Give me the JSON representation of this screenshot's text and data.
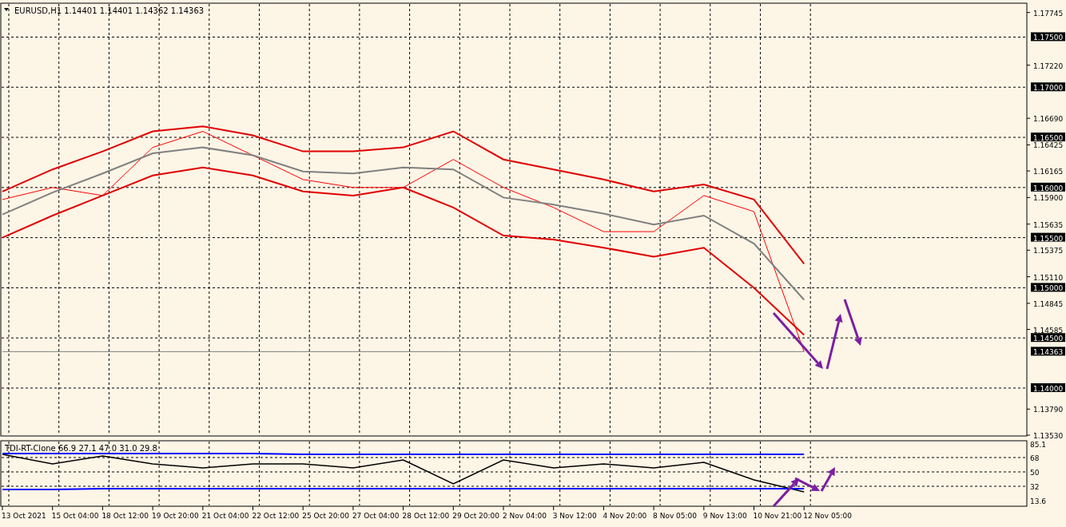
{
  "main": {
    "header": "EURUSD,H1  1.14401 1.14401 1.14362 1.14363",
    "chart_data": {
      "type": "line",
      "grid": true,
      "series": [
        {
          "color": "#ff0000",
          "values": [
            1.1588,
            1.16,
            1.1592,
            1.164,
            1.1656,
            1.1632,
            1.1608,
            1.16,
            1.16,
            1.1628,
            1.16,
            1.158,
            1.1556,
            1.1556,
            1.1592,
            1.1576,
            1.14363
          ]
        },
        {
          "color": "#e00000",
          "values": [
            1.1596,
            1.1618,
            1.1636,
            1.1656,
            1.1661,
            1.1652,
            1.1636,
            1.1636,
            1.164,
            1.1656,
            1.1628,
            1.1618,
            1.1608,
            1.1596,
            1.1603,
            1.1588,
            1.1524
          ]
        },
        {
          "color": "#808080",
          "values": [
            1.1573,
            1.1595,
            1.1614,
            1.1634,
            1.164,
            1.1632,
            1.1616,
            1.1614,
            1.162,
            1.1618,
            1.159,
            1.1583,
            1.1574,
            1.1563,
            1.1572,
            1.1544,
            1.1488
          ]
        },
        {
          "color": "#e00000",
          "values": [
            1.155,
            1.1572,
            1.1592,
            1.1612,
            1.162,
            1.1612,
            1.1596,
            1.1592,
            1.16,
            1.158,
            1.1552,
            1.1548,
            1.154,
            1.1531,
            1.154,
            1.15,
            1.1453
          ]
        },
        {
          "color": "#808080",
          "values": [
            1.14363,
            1.14363,
            1.14363,
            1.14363,
            1.14363,
            1.14363,
            1.14363,
            1.14363,
            1.14363,
            1.14363,
            1.14363,
            1.14363,
            1.14363,
            1.14363,
            1.14363,
            1.14363,
            1.14363
          ]
        }
      ],
      "ylim": [
        1.1353,
        1.1783
      ],
      "yticks": [
        {
          "value": 1.17745,
          "label": "1.17745"
        },
        {
          "value": 1.175,
          "label": "1.17500"
        },
        {
          "value": 1.1722,
          "label": "1.17220"
        },
        {
          "value": 1.17,
          "label": "1.17000"
        },
        {
          "value": 1.1669,
          "label": "1.16690"
        },
        {
          "value": 1.165,
          "label": "1.16500"
        },
        {
          "value": 1.16425,
          "label": "1.16425"
        },
        {
          "value": 1.16165,
          "label": "1.16165"
        },
        {
          "value": 1.16,
          "label": "1.16000"
        },
        {
          "value": 1.159,
          "label": "1.15900"
        },
        {
          "value": 1.15635,
          "label": "1.15635"
        },
        {
          "value": 1.155,
          "label": "1.15500"
        },
        {
          "value": 1.15375,
          "label": "1.15375"
        },
        {
          "value": 1.1511,
          "label": "1.15110"
        },
        {
          "value": 1.15,
          "label": "1.15000"
        },
        {
          "value": 1.14845,
          "label": "1.14845"
        },
        {
          "value": 1.14585,
          "label": "1.14585"
        },
        {
          "value": 1.145,
          "label": "1.14500"
        },
        {
          "value": 1.14363,
          "label": "1.14363"
        },
        {
          "value": 1.14,
          "label": "1.14000"
        },
        {
          "value": 1.1379,
          "label": "1.13790"
        },
        {
          "value": 1.1353,
          "label": "1.13530"
        }
      ]
    }
  },
  "indicator": {
    "header": "TDI-RT-Clone 66.9 27.1 47.0 31.0 29.8",
    "chart_data": {
      "type": "line",
      "grid": true,
      "categories": [
        "13 Oct 2021",
        "15 Oct 04:00",
        "18 Oct 12:00",
        "19 Oct 20:00",
        "21 Oct 04:00",
        "22 Oct 12:00",
        "25 Oct 20:00",
        "27 Oct 04:00",
        "28 Oct 12:00",
        "29 Oct 20:00",
        "2 Nov 04:00",
        "3 Nov 12:00",
        "4 Nov 20:00",
        "8 Nov 05:00",
        "9 Nov 13:00",
        "10 Nov 21:00",
        "12 Nov 05:00"
      ],
      "series": [
        {
          "color": "#000000",
          "values": [
            72,
            60,
            70,
            60,
            55,
            60,
            60,
            55,
            65,
            35,
            65,
            55,
            60,
            55,
            62,
            40,
            25
          ]
        },
        {
          "color": "#0000ff",
          "values": [
            73,
            73,
            73,
            73,
            73,
            73,
            72,
            72,
            72,
            72,
            72,
            72,
            72,
            72,
            72,
            72,
            72
          ]
        },
        {
          "color": "#0000ff",
          "values": [
            28,
            28,
            29,
            29,
            29,
            29,
            29,
            29,
            29,
            29,
            29,
            29,
            29,
            29,
            29,
            29,
            29
          ]
        }
      ],
      "ylim": [
        8,
        88
      ],
      "yticks": [
        {
          "value": 85.1,
          "label": "85.1"
        },
        {
          "value": 68,
          "label": "68"
        },
        {
          "value": 50,
          "label": "50"
        },
        {
          "value": 32,
          "label": "32"
        },
        {
          "value": 13.6,
          "label": "13.6"
        }
      ]
    }
  }
}
